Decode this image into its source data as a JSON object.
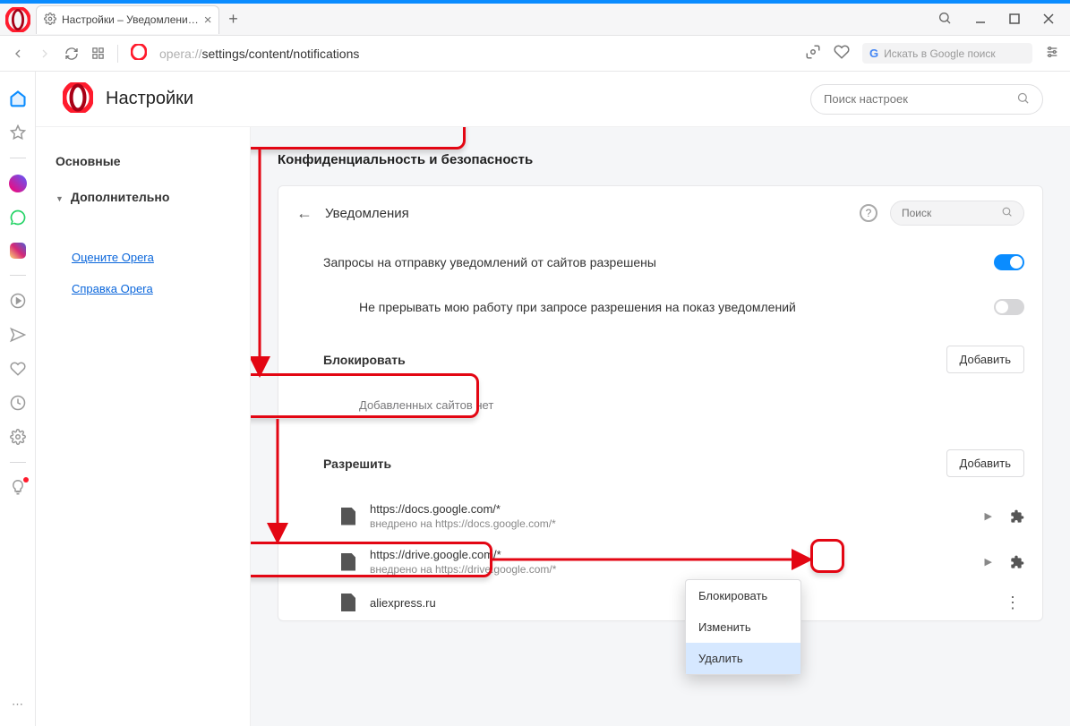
{
  "window": {
    "tab_title": "Настройки – Уведомлени…"
  },
  "url": {
    "prefix": "opera://",
    "path": "settings/content/notifications"
  },
  "google_search_placeholder": "Искать в Google поиск",
  "header": {
    "title": "Настройки",
    "search_placeholder": "Поиск настроек"
  },
  "sidenav": {
    "main": "Основные",
    "advanced": "Дополнительно",
    "rate": "Оцените Opera",
    "help": "Справка Opera"
  },
  "page": {
    "section": "Конфиденциальность и безопасность",
    "back_label": "Уведомления",
    "mini_search_placeholder": "Поиск",
    "setting1": "Запросы на отправку уведомлений от сайтов разрешены",
    "setting2": "Не прерывать мою работу при запросе разрешения на показ уведомлений",
    "block_title": "Блокировать",
    "add_btn": "Добавить",
    "empty_text": "Добавленных сайтов нет",
    "allow_title": "Разрешить",
    "sites": [
      {
        "url": "https://docs.google.com/*",
        "sub": "внедрено на https://docs.google.com/*",
        "extension": true
      },
      {
        "url": "https://drive.google.com/*",
        "sub": "внедрено на https://drive.google.com/*",
        "extension": true
      },
      {
        "url": "aliexpress.ru",
        "sub": "",
        "extension": false
      }
    ]
  },
  "context_menu": {
    "block": "Блокировать",
    "edit": "Изменить",
    "delete": "Удалить"
  }
}
